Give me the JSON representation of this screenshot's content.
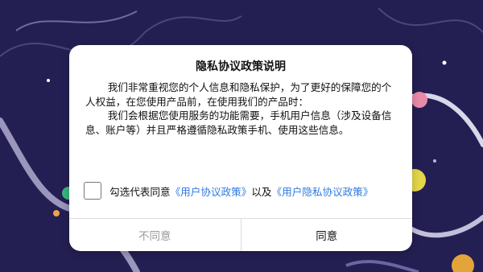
{
  "dialog": {
    "title": "隐私协议政策说明",
    "paragraph1": "我们非常重视您的个人信息和隐私保护，为了更好的保障您的个人权益，在您使用产品前，在使用我们的产品时：",
    "paragraph2": "我们会根据您使用服务的功能需要，手机用户信息（涉及设备信息、账户等）并且严格遵循隐私政策手机、使用这些信息。",
    "consent": {
      "prefix": "勾选代表同意",
      "link_user_agreement": "《用户协议政策》",
      "middle": "以及",
      "link_privacy_agreement": "《用户隐私协议政策》",
      "checked": false
    },
    "buttons": {
      "disagree": "不同意",
      "agree": "同意"
    }
  },
  "colors": {
    "background": "#241f52",
    "link": "#2f7be0",
    "disabled_text": "#9a9a9a"
  }
}
